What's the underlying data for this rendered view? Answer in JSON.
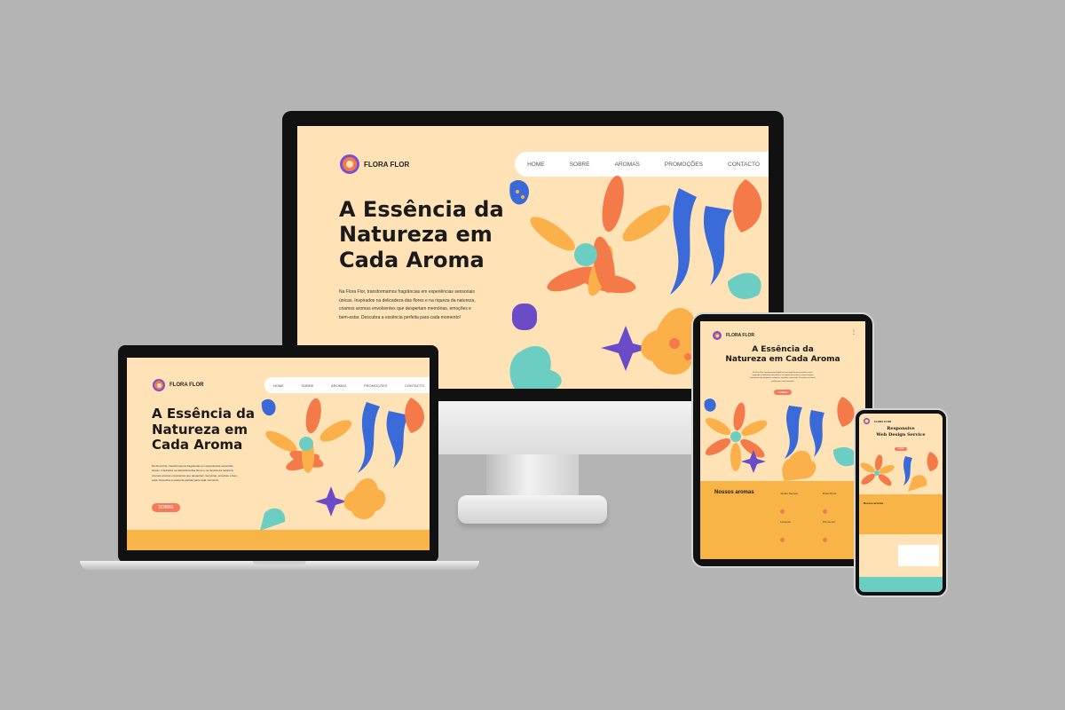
{
  "brand": {
    "name": "FLORA FLOR"
  },
  "nav": {
    "items": [
      "HOME",
      "SOBRE",
      "AROMAS",
      "PROMOÇÕES",
      "CONTACTO"
    ]
  },
  "hero": {
    "title_line1": "A Essência da",
    "title_line2": "Natureza em",
    "title_line3": "Cada Aroma",
    "title_short": "Natureza em Cada Aroma",
    "paragraph": "Na Flora Flor, transformamos fragrâncias em experiências sensoriais únicas. Inspirados na delicadeza das flores e na riqueza da natureza, criamos aromas envolventes que despertam memórias, emoções e bem-estar. Descubra a essência perfeita para cada momento!",
    "cta": "SOBRE"
  },
  "tablet": {
    "section_title": "Nossos aromas",
    "products": [
      "Jardim Secreto",
      "Brisa Floral",
      "Lavanda",
      "Pôr-do-sol"
    ]
  },
  "phone": {
    "title_line1": "Responsive",
    "title_line2": "Web Design Service",
    "section_title": "Nossos aromas"
  },
  "colors": {
    "background": "#b4b4b4",
    "cream": "#ffe3b6",
    "orange": "#f9b448",
    "coral": "#f47a4a",
    "blue": "#3a6ad8",
    "teal": "#6ccdc2",
    "purple": "#6a4cc8",
    "pink": "#ee8ea0"
  }
}
